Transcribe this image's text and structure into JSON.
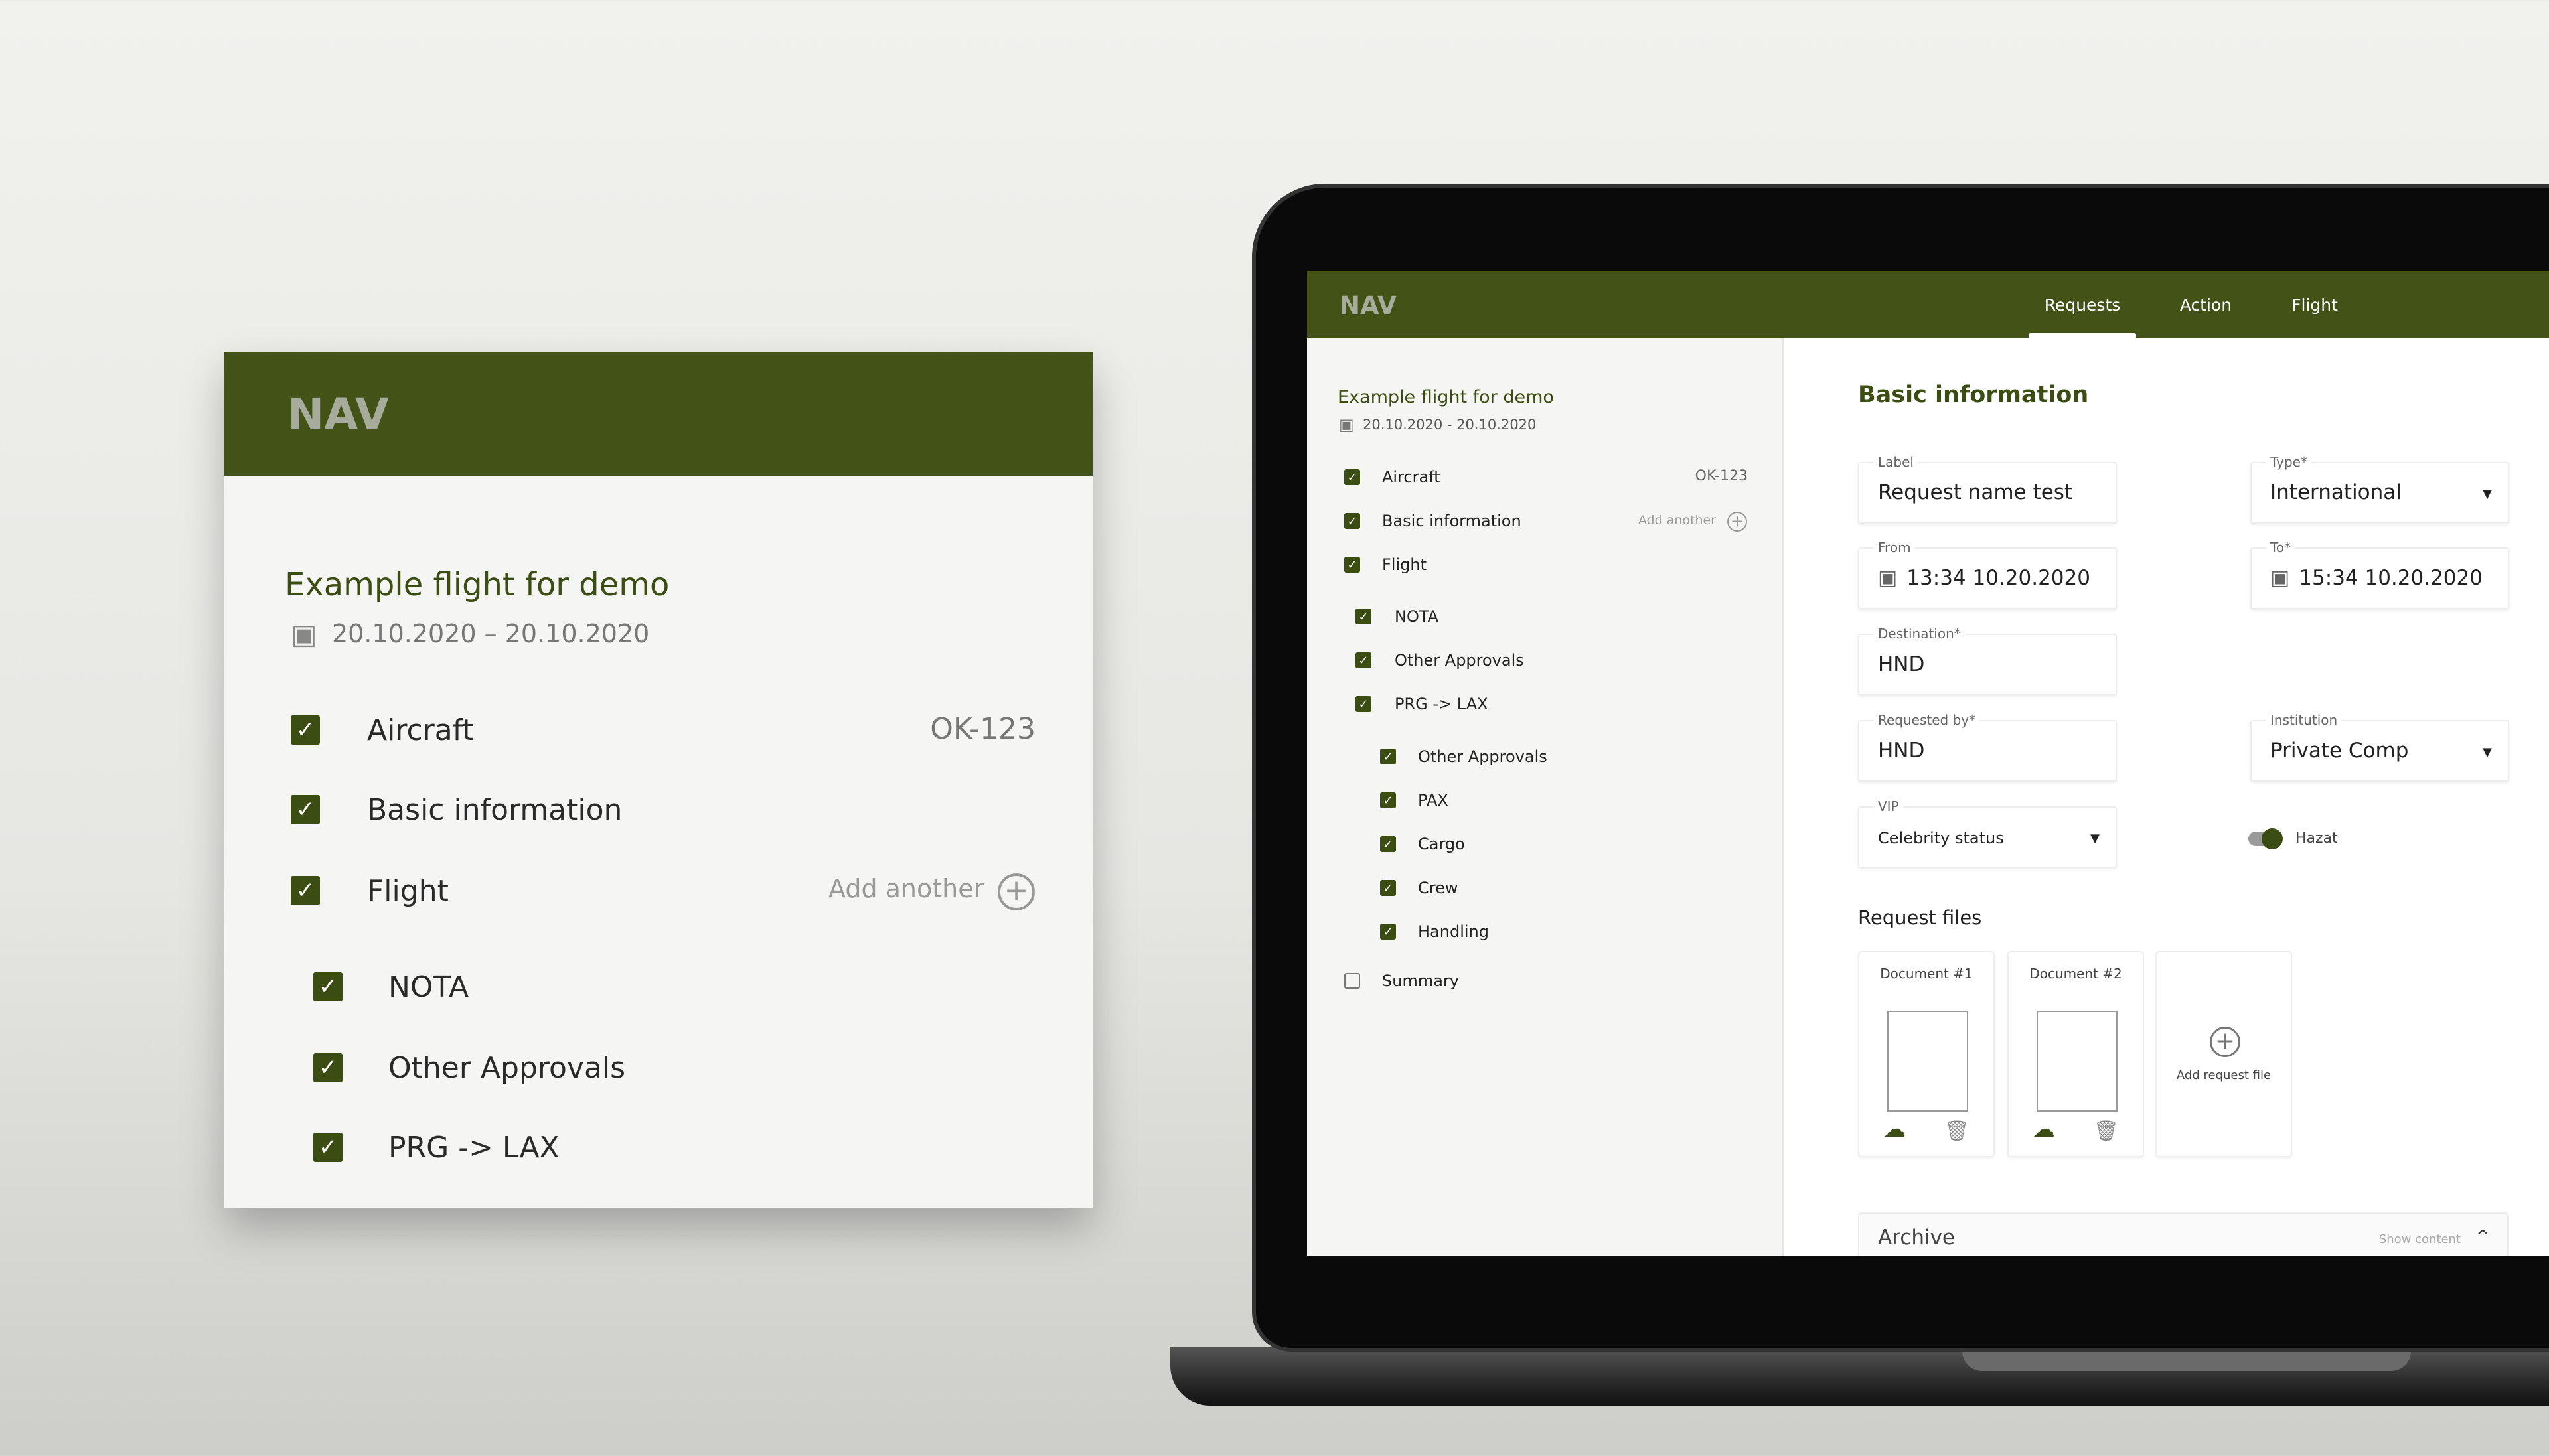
{
  "colors": {
    "brand": "#435317",
    "accent": "#3b4d12"
  },
  "card": {
    "logo": "NAV",
    "title": "Example flight for demo",
    "date": "20.10.2020 – 20.10.2020",
    "items": [
      {
        "label": "Aircraft",
        "value": "OK-123",
        "checked": true
      },
      {
        "label": "Basic information",
        "checked": true
      },
      {
        "label": "Flight",
        "action": "Add another",
        "checked": true
      },
      {
        "label": "NOTA",
        "checked": true
      },
      {
        "label": "Other Approvals",
        "checked": true
      },
      {
        "label": "PRG -> LAX",
        "checked": true
      }
    ]
  },
  "app": {
    "logo": "NAV",
    "tabs": [
      {
        "label": "Requests",
        "active": true
      },
      {
        "label": "Action"
      },
      {
        "label": "Flight"
      }
    ],
    "sidebar": {
      "title": "Example flight for demo",
      "date": "20.10.2020 - 20.10.2020",
      "items": [
        {
          "label": "Aircraft",
          "value": "OK-123",
          "checked": true
        },
        {
          "label": "Basic information",
          "checked": true
        },
        {
          "label": "Flight",
          "action": "Add another",
          "checked": true
        },
        {
          "label": "NOTA",
          "checked": true
        },
        {
          "label": "Other Approvals",
          "checked": true
        },
        {
          "label": "PRG -> LAX",
          "checked": true
        },
        {
          "label": "Other Approvals",
          "checked": true
        },
        {
          "label": "PAX",
          "checked": true
        },
        {
          "label": "Cargo",
          "checked": true
        },
        {
          "label": "Crew",
          "checked": true
        },
        {
          "label": "Handling",
          "checked": true
        },
        {
          "label": "Summary",
          "checked": false
        }
      ]
    },
    "main": {
      "heading": "Basic information",
      "fields": {
        "label": {
          "label": "Label",
          "value": "Request name test"
        },
        "type": {
          "label": "Type*",
          "value": "International"
        },
        "from": {
          "label": "From",
          "value": "13:34 10.20.2020"
        },
        "to": {
          "label": "To*",
          "value": "15:34 10.20.2020"
        },
        "destination": {
          "label": "Destination*",
          "value": "HND"
        },
        "requested_by": {
          "label": "Requested by*",
          "value": "HND"
        },
        "institution": {
          "label": "Institution",
          "value": "Private Comp"
        },
        "vip": {
          "label": "VIP",
          "value": "Celebrity status"
        }
      },
      "hazat": {
        "label": "Hazat",
        "on": true
      },
      "files_heading": "Request files",
      "documents": [
        {
          "title": "Document #1"
        },
        {
          "title": "Document #2"
        }
      ],
      "add_file": "Add request file",
      "archive": {
        "title": "Archive",
        "toggle": "Show content"
      }
    }
  }
}
